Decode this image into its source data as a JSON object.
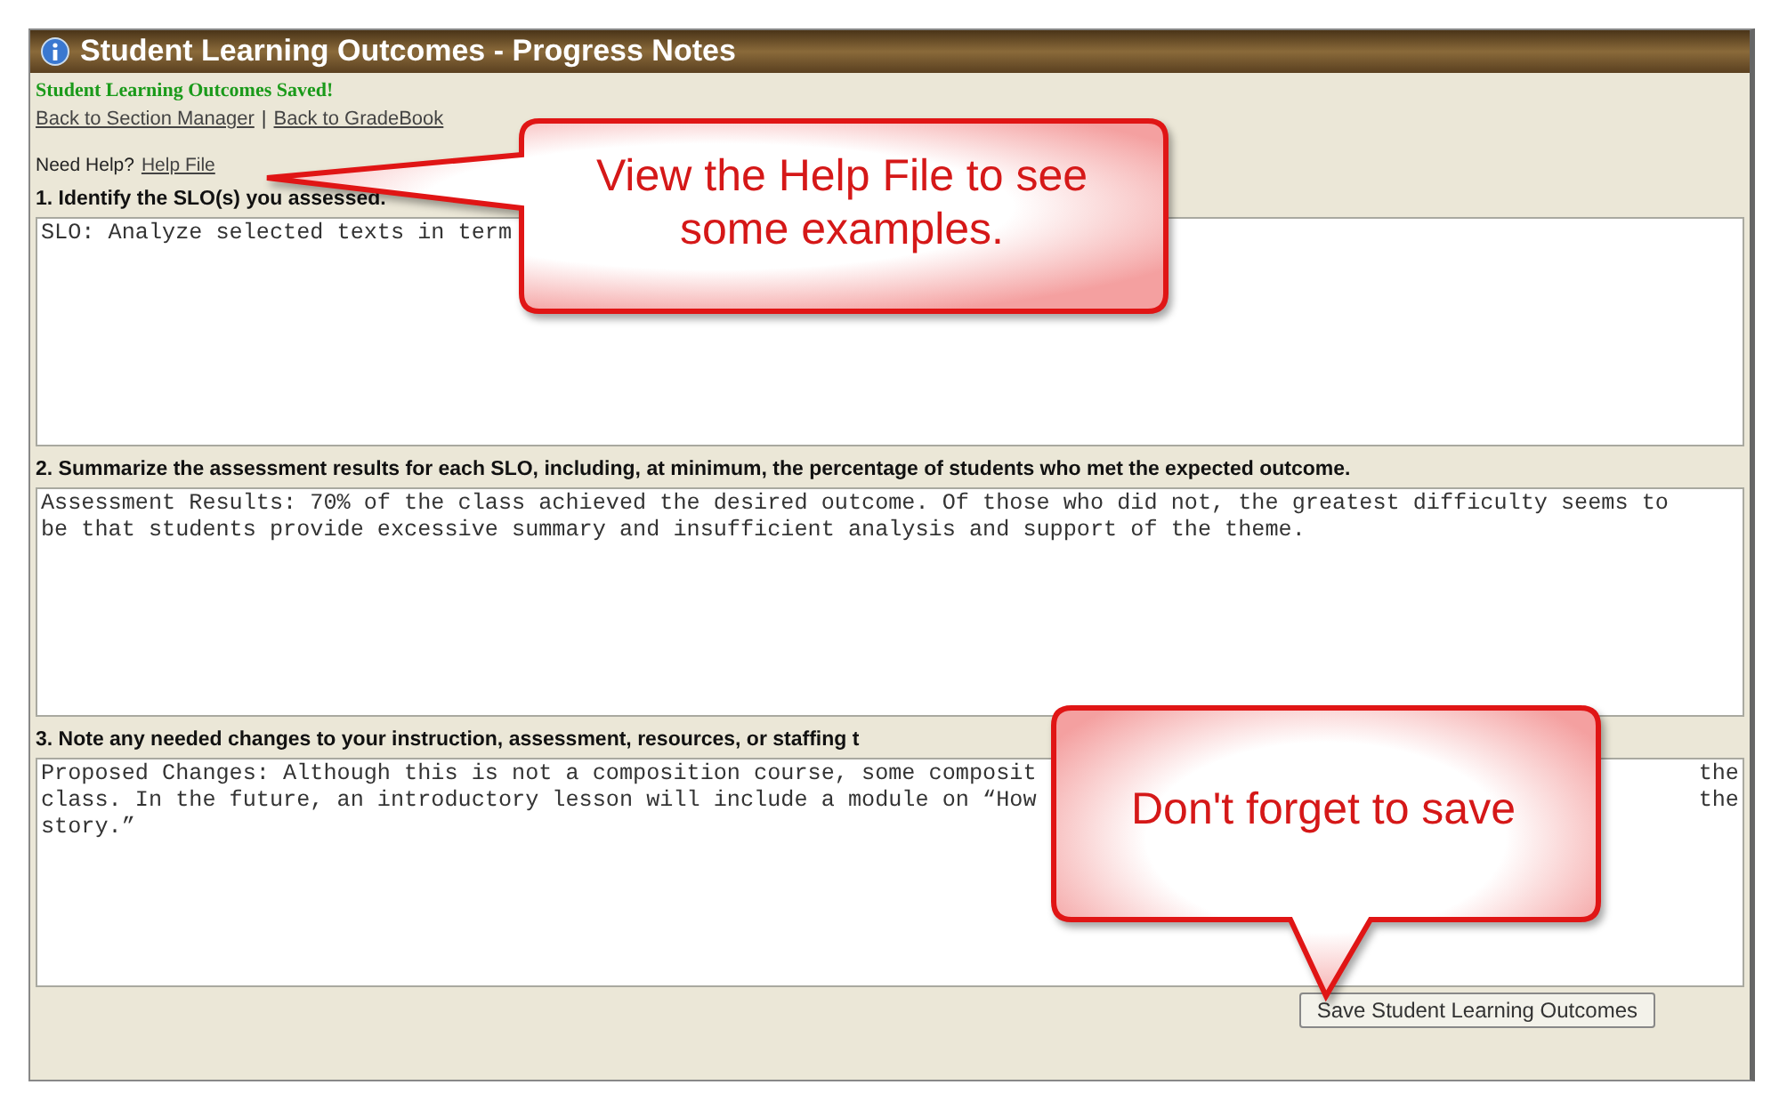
{
  "window": {
    "title": "Student Learning Outcomes - Progress Notes"
  },
  "status_message": "Student Learning Outcomes Saved!",
  "nav_links": [
    "Back to Section Manager",
    "Back to GradeBook"
  ],
  "nav_separator": "|",
  "help": {
    "label": "Need Help?",
    "link": "Help File"
  },
  "sections": [
    {
      "heading": "1. Identify the SLO(s) you assessed.",
      "lines": [
        {
          "text": "SLO: Analyze selected texts in term"
        }
      ]
    },
    {
      "heading": "2. Summarize the assessment results for each SLO, including, at minimum, the percentage of students who met the expected outcome.",
      "lines": [
        {
          "text": "Assessment Results: 70% of the class achieved the desired outcome. Of those who did not, the greatest difficulty seems to"
        },
        {
          "text": "be that students provide excessive summary and insufficient analysis and support of the theme."
        }
      ]
    },
    {
      "heading": "3. Note any needed changes to your instruction, assessment, resources, or staffing t",
      "lines": [
        {
          "text": "Proposed Changes: Although this is not a composition course, some composit",
          "tail": "the"
        },
        {
          "text": "class. In the future, an introductory lesson will include a module on “How",
          "tail": "the"
        },
        {
          "text": "story.”"
        }
      ]
    }
  ],
  "save_button": "Save Student Learning Outcomes",
  "callouts": [
    {
      "text": "View the Help File to see some examples.",
      "kind": "side"
    },
    {
      "text": "Don't forget to save",
      "kind": "bottom"
    }
  ]
}
